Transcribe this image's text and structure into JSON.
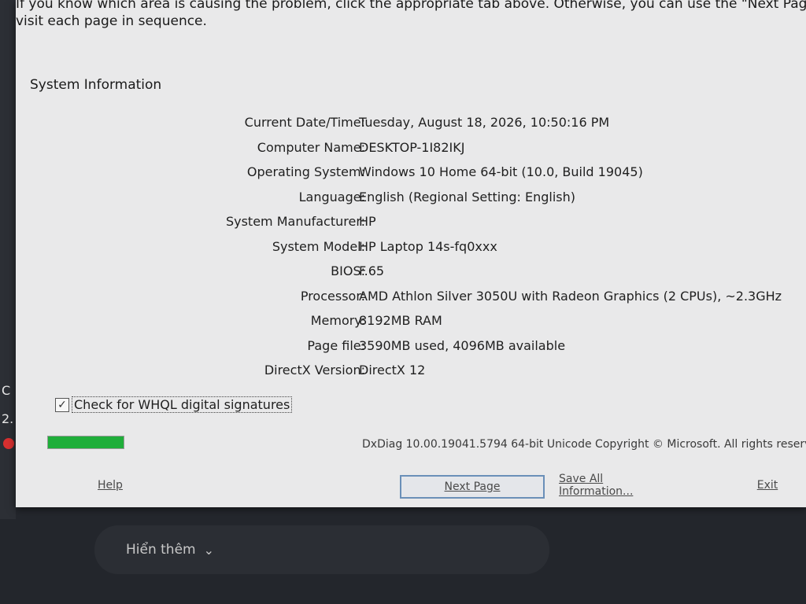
{
  "intro": {
    "line1": "If you know which area is causing the problem, click the appropriate tab above. Otherwise, you can use the \"Next Page\" button",
    "line2": "visit each page in sequence."
  },
  "section_title": "System Information",
  "info_rows": [
    {
      "label": "Current Date/Time:",
      "value": "Tuesday, August 18, 2026, 10:50:16 PM"
    },
    {
      "label": "Computer Name:",
      "value": "DESKTOP-1I82IKJ"
    },
    {
      "label": "Operating System:",
      "value": "Windows 10 Home 64-bit (10.0, Build 19045)"
    },
    {
      "label": "Language:",
      "value": "English (Regional Setting: English)"
    },
    {
      "label": "System Manufacturer:",
      "value": "HP"
    },
    {
      "label": "System Model:",
      "value": "HP Laptop 14s-fq0xxx"
    },
    {
      "label": "BIOS:",
      "value": "F.65"
    },
    {
      "label": "Processor:",
      "value": "AMD Athlon Silver 3050U with Radeon Graphics     (2 CPUs), ~2.3GHz"
    },
    {
      "label": "Memory:",
      "value": "8192MB RAM"
    },
    {
      "label": "Page file:",
      "value": "3590MB used, 4096MB available"
    },
    {
      "label": "DirectX Version:",
      "value": "DirectX 12"
    }
  ],
  "whql": {
    "label": "Check for WHQL digital signatures",
    "checked": true,
    "check_glyph": "✓"
  },
  "progress": {
    "fraction": 1.0,
    "color": "#1fae3a"
  },
  "version_text": "DxDiag 10.00.19041.5794 64-bit Unicode  Copyright © Microsoft. All rights reserv",
  "buttons": {
    "help": "Help",
    "next_page": "Next Page",
    "save_all": "Save All Information...",
    "exit": "Exit"
  },
  "left_strip": {
    "glyph_1": "C",
    "glyph_2": "2."
  },
  "bottom": {
    "show_more": "Hiển thêm",
    "chevron": "⌄"
  }
}
